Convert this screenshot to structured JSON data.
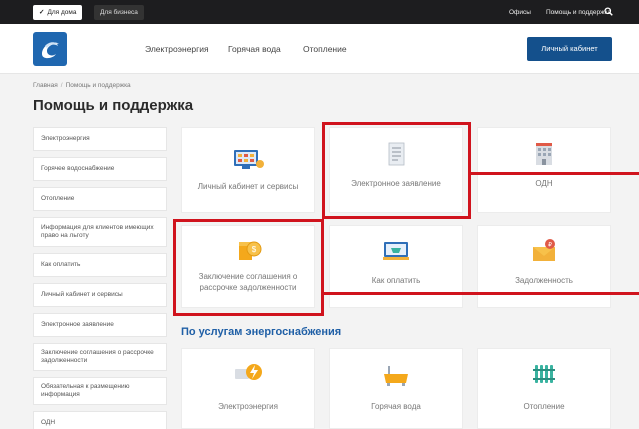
{
  "topbar": {
    "home_label": "Для дома",
    "business_label": "Для бизнеса",
    "offices": "Офисы",
    "help": "Помощь и поддержка"
  },
  "header": {
    "nav": [
      "Электроэнергия",
      "Горячая вода",
      "Отопление"
    ],
    "cabinet_button": "Личный кабинет"
  },
  "breadcrumb": {
    "home": "Главная",
    "sep": "/",
    "current": "Помощь и поддержка"
  },
  "page_title": "Помощь и поддержка",
  "sidebar": {
    "items": [
      "Электроэнергия",
      "Горячее водоснабжение",
      "Отопление",
      "Информация для клиентов имеющих право на льготу",
      "Как оплатить",
      "Личный кабинет и сервисы",
      "Электронное заявление",
      "Заключение соглашения о рассрочке задолженности",
      "Обязательная к размещению информация",
      "ОДН"
    ]
  },
  "tiles": [
    "Личный кабинет и сервисы",
    "Электронное заявление",
    "ОДН",
    "Заключение соглашения о рассрочке задолженности",
    "Как оплатить",
    "Задолженность"
  ],
  "section_title": "По услугам энергоснабжения",
  "service_tiles": [
    "Электроэнергия",
    "Горячая вода",
    "Отопление"
  ],
  "colors": {
    "accent": "#1f5fa6",
    "button": "#14508c",
    "highlight": "#d0131d",
    "topbar": "#1d1d1f"
  }
}
